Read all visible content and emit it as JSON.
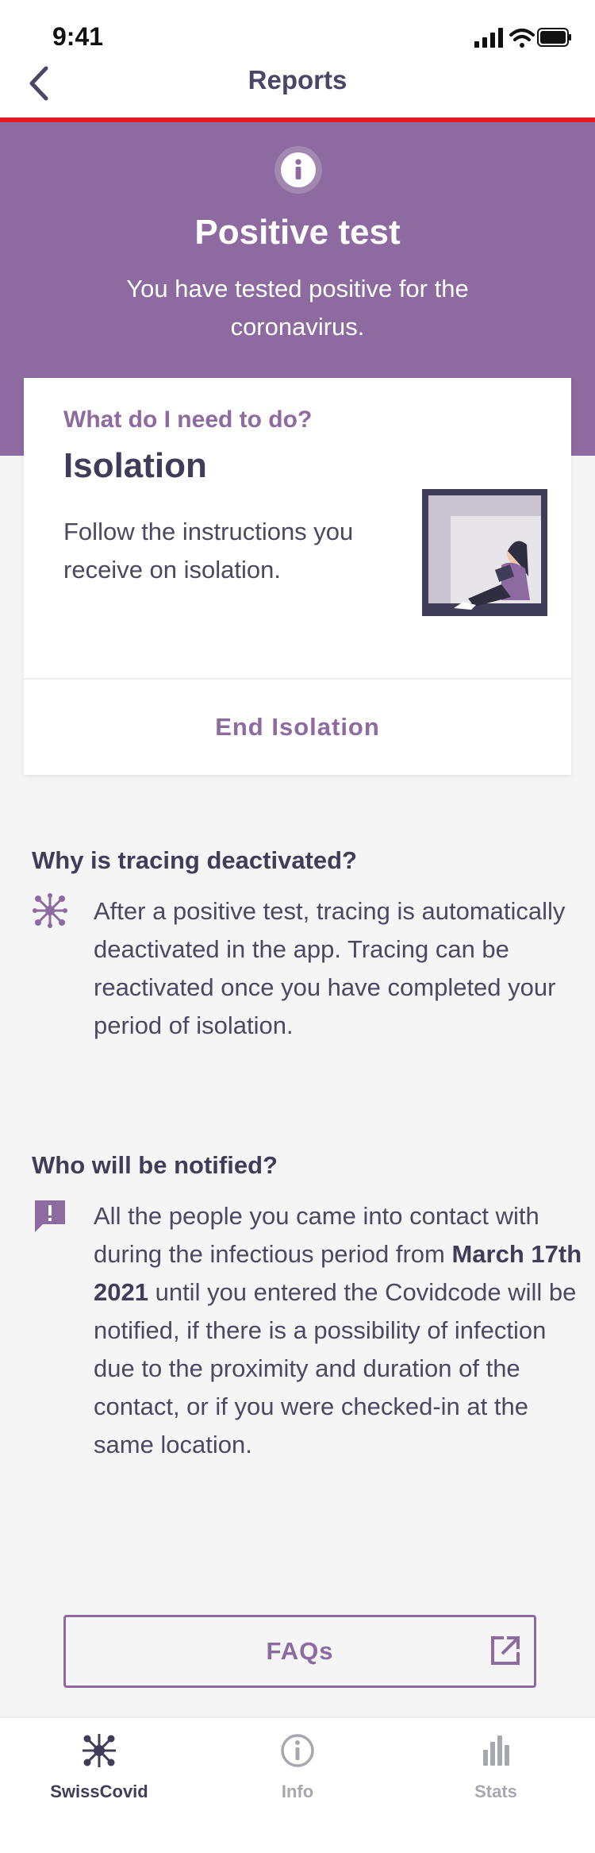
{
  "status_bar": {
    "time": "9:41"
  },
  "nav": {
    "title": "Reports"
  },
  "hero": {
    "title": "Positive test",
    "subtitle": "You have tested positive for the coronavirus."
  },
  "card": {
    "kicker": "What do I need to do?",
    "title": "Isolation",
    "text": "Follow the instructions you receive on isolation.",
    "action": "End Isolation"
  },
  "tracing": {
    "title": "Why is tracing deactivated?",
    "body": "After a positive test, tracing is automatically deactivated in the app. Tracing can be reactivated once you have completed your period of isolation."
  },
  "notified": {
    "title": "Who will be notified?",
    "body_before": "All the people you came into contact with during the infectious period from ",
    "date": "March 17th 2021",
    "body_after": " until you entered the Covidcode will be notified, if there is a possibility of infection due to the proximity and duration of the contact, or if you were checked-in at the same location."
  },
  "faq": {
    "label": "FAQs"
  },
  "tabs": [
    {
      "label": "SwissCovid",
      "icon": "swisscovid-icon",
      "active": true
    },
    {
      "label": "Info",
      "icon": "info-icon",
      "active": false
    },
    {
      "label": "Stats",
      "icon": "stats-icon",
      "active": false
    }
  ],
  "colors": {
    "accent": "#8d6a9f",
    "alert_line": "#e11b22",
    "text_dark": "#3f3d57",
    "tab_inactive": "#a7a7b0"
  }
}
